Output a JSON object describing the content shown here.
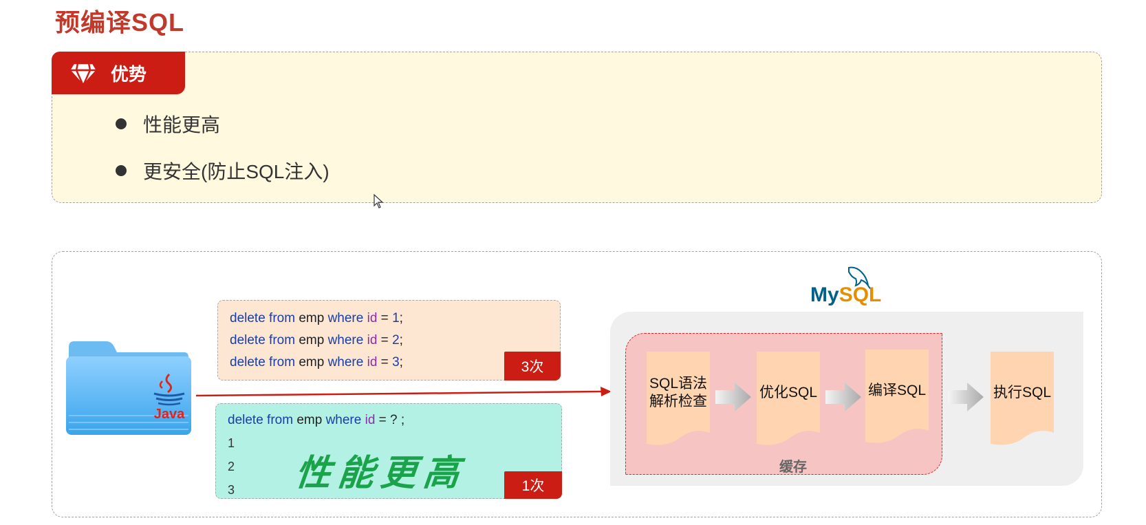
{
  "page": {
    "title": "预编译SQL"
  },
  "advantages": {
    "tab_label": "优势",
    "items": [
      {
        "text": "性能更高"
      },
      {
        "text": "更安全(防止SQL注入)"
      }
    ]
  },
  "diagram": {
    "client_label": "Java",
    "statements_box": {
      "lines": [
        {
          "kw1": "delete from",
          "table": " emp ",
          "kw2": "where",
          "col": " id",
          "op": " = ",
          "val": "1",
          "end": ";"
        },
        {
          "kw1": "delete from",
          "table": " emp ",
          "kw2": "where",
          "col": " id",
          "op": " = ",
          "val": "2",
          "end": ";"
        },
        {
          "kw1": "delete from",
          "table": " emp ",
          "kw2": "where",
          "col": " id",
          "op": " = ",
          "val": "3",
          "end": ";"
        }
      ],
      "badge": "3次"
    },
    "prepared_box": {
      "line": {
        "kw1": "delete from",
        "table": " emp ",
        "kw2": "where",
        "col": " id",
        "rest": " = ? ;"
      },
      "params": [
        "1",
        "2",
        "3"
      ],
      "slogan": "性能更高",
      "badge": "1次"
    },
    "mysql": {
      "logo_my": "My",
      "logo_sql": "SQL",
      "cache_label": "缓存",
      "steps": [
        {
          "line1": "SQL语法",
          "line2": "解析检查"
        },
        {
          "line1": "优化SQL",
          "line2": ""
        },
        {
          "line1": "编译SQL",
          "line2": ""
        },
        {
          "line1": "执行SQL",
          "line2": ""
        }
      ]
    },
    "colors": {
      "accent_red": "#cc1d14",
      "panel_yellow": "#fff9e0",
      "statements_bg": "#fde6d2",
      "prepared_bg": "#b3f1e4",
      "cache_bg": "#f7c4c4",
      "step_bg": "#fed5b0"
    }
  }
}
